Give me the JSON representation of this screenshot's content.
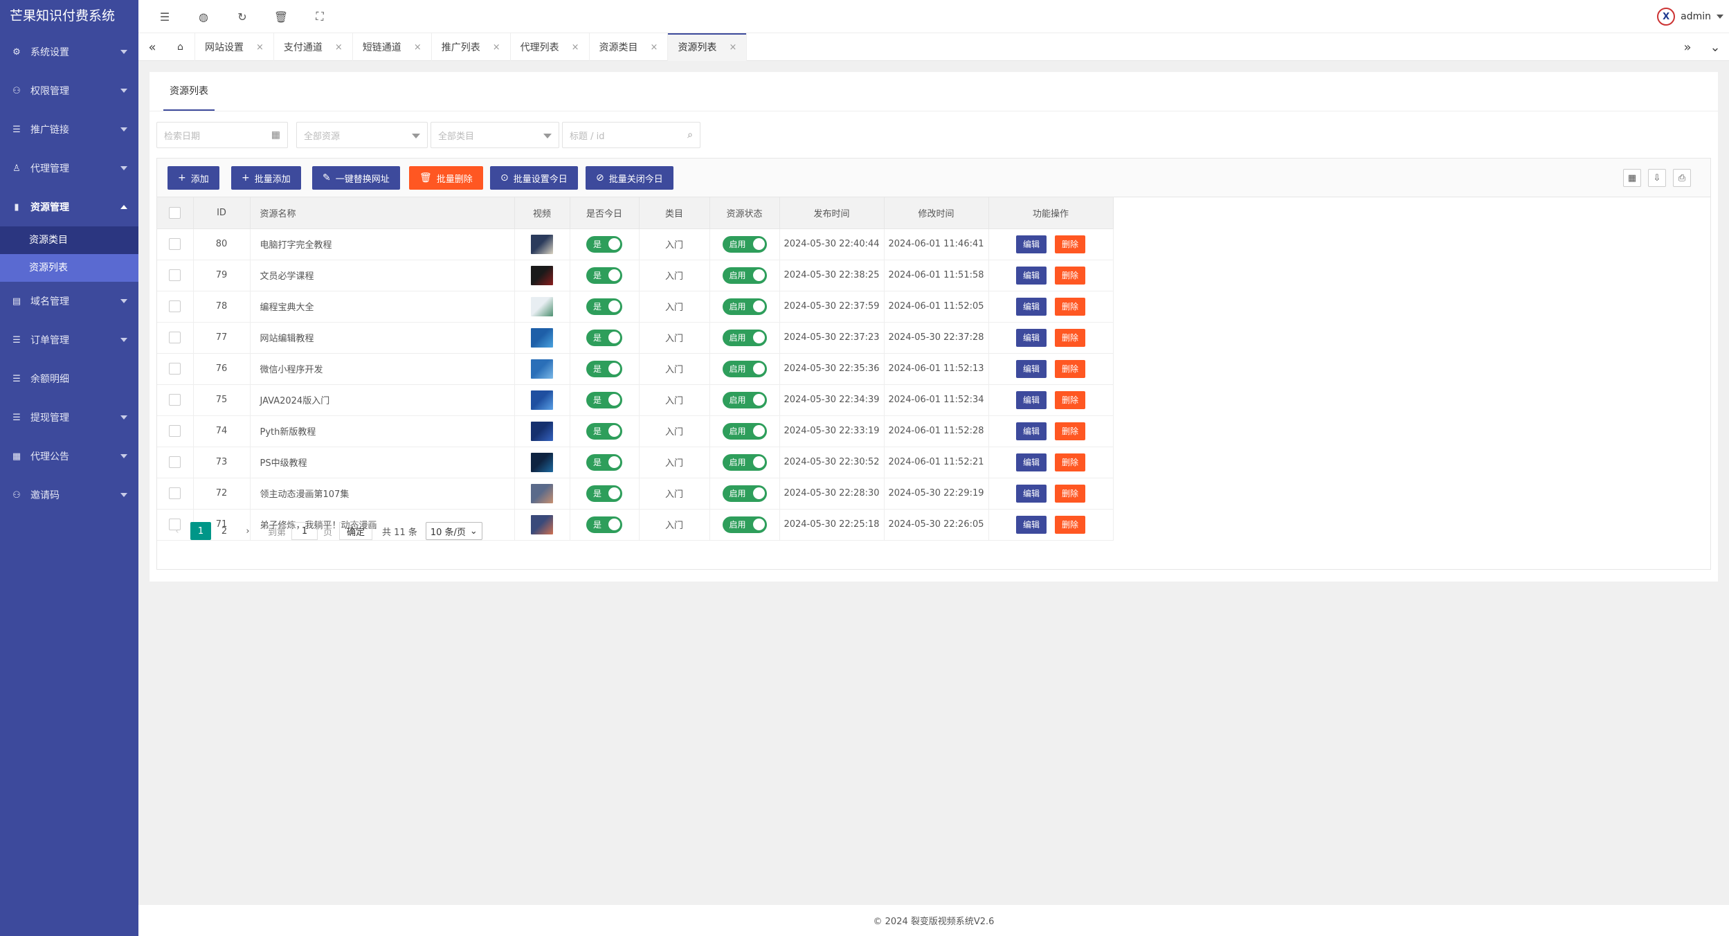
{
  "app": {
    "title": "芒果知识付费系统"
  },
  "colors": {
    "primary": "#3d4a9c",
    "danger": "#ff5722",
    "success": "#2e9e5b",
    "pager_active": "#009688"
  },
  "sidebar": {
    "items": [
      {
        "label": "系统设置",
        "icon": "gear-icon",
        "has_caret": true
      },
      {
        "label": "权限管理",
        "icon": "users-icon",
        "has_caret": true
      },
      {
        "label": "推广链接",
        "icon": "list-icon",
        "has_caret": true
      },
      {
        "label": "代理管理",
        "icon": "agent-icon",
        "has_caret": true
      },
      {
        "label": "资源管理",
        "icon": "book-icon",
        "has_caret": true,
        "open": true,
        "children": [
          {
            "label": "资源类目"
          },
          {
            "label": "资源列表",
            "active": true
          }
        ]
      },
      {
        "label": "域名管理",
        "icon": "domain-icon",
        "has_caret": true
      },
      {
        "label": "订单管理",
        "icon": "list-icon",
        "has_caret": true
      },
      {
        "label": "余额明细",
        "icon": "list-icon",
        "has_caret": false
      },
      {
        "label": "提现管理",
        "icon": "list-icon",
        "has_caret": true
      },
      {
        "label": "代理公告",
        "icon": "grid-icon",
        "has_caret": true
      },
      {
        "label": "邀请码",
        "icon": "users-icon",
        "has_caret": true
      }
    ]
  },
  "header": {
    "user": "admin"
  },
  "tabs": [
    {
      "label": "网站设置"
    },
    {
      "label": "支付通道"
    },
    {
      "label": "短链通道"
    },
    {
      "label": "推广列表"
    },
    {
      "label": "代理列表"
    },
    {
      "label": "资源类目"
    },
    {
      "label": "资源列表",
      "active": true
    }
  ],
  "card": {
    "tab_label": "资源列表"
  },
  "filters": {
    "date_placeholder": "检索日期",
    "resource_placeholder": "全部资源",
    "category_placeholder": "全部类目",
    "keyword_placeholder": "标题 / id"
  },
  "toolbar": {
    "add": "添加",
    "batch_add": "批量添加",
    "replace_url": "一键替换网址",
    "batch_delete": "批量删除",
    "batch_set_today": "批量设置今日",
    "batch_close_today": "批量关闭今日"
  },
  "table": {
    "columns": [
      "ID",
      "资源名称",
      "视频",
      "是否今日",
      "类目",
      "资源状态",
      "发布时间",
      "修改时间",
      "功能操作"
    ],
    "rows": [
      {
        "id": "80",
        "name": "电脑打字完全教程",
        "today": "是",
        "category": "入门",
        "status": "启用",
        "published": "2024-05-30 22:40:44",
        "modified": "2024-06-01 11:46:41",
        "thumb": [
          "#2b3b5c",
          "#d9d2c0"
        ]
      },
      {
        "id": "79",
        "name": "文员必学课程",
        "today": "是",
        "category": "入门",
        "status": "启用",
        "published": "2024-05-30 22:38:25",
        "modified": "2024-06-01 11:51:58",
        "thumb": [
          "#1a1a1a",
          "#8b1d1d"
        ]
      },
      {
        "id": "78",
        "name": "编程宝典大全",
        "today": "是",
        "category": "入门",
        "status": "启用",
        "published": "2024-05-30 22:37:59",
        "modified": "2024-06-01 11:52:05",
        "thumb": [
          "#e8eef2",
          "#4c8f6f"
        ]
      },
      {
        "id": "77",
        "name": "网站编辑教程",
        "today": "是",
        "category": "入门",
        "status": "启用",
        "published": "2024-05-30 22:37:23",
        "modified": "2024-05-30 22:37:28",
        "thumb": [
          "#1e5fa8",
          "#4aa3df"
        ]
      },
      {
        "id": "76",
        "name": "微信小程序开发",
        "today": "是",
        "category": "入门",
        "status": "启用",
        "published": "2024-05-30 22:35:36",
        "modified": "2024-06-01 11:52:13",
        "thumb": [
          "#2a6fb8",
          "#7ab8e8"
        ]
      },
      {
        "id": "75",
        "name": "JAVA2024版入门",
        "today": "是",
        "category": "入门",
        "status": "启用",
        "published": "2024-05-30 22:34:39",
        "modified": "2024-06-01 11:52:34",
        "thumb": [
          "#1f4fa0",
          "#5aa0e6"
        ]
      },
      {
        "id": "74",
        "name": "Pyth新版教程",
        "today": "是",
        "category": "入门",
        "status": "启用",
        "published": "2024-05-30 22:33:19",
        "modified": "2024-06-01 11:52:28",
        "thumb": [
          "#15306e",
          "#3563c0"
        ]
      },
      {
        "id": "73",
        "name": "PS中级教程",
        "today": "是",
        "category": "入门",
        "status": "启用",
        "published": "2024-05-30 22:30:52",
        "modified": "2024-06-01 11:52:21",
        "thumb": [
          "#0e2340",
          "#1e6aa0"
        ]
      },
      {
        "id": "72",
        "name": "领主动态漫画第107集",
        "today": "是",
        "category": "入门",
        "status": "启用",
        "published": "2024-05-30 22:28:30",
        "modified": "2024-05-30 22:29:19",
        "thumb": [
          "#5a6a8a",
          "#c89070"
        ]
      },
      {
        "id": "71",
        "name": "弟子修炼，我躺平！动态漫画",
        "today": "是",
        "category": "入门",
        "status": "启用",
        "published": "2024-05-30 22:25:18",
        "modified": "2024-05-30 22:26:05",
        "thumb": [
          "#3a4a7a",
          "#d07050"
        ]
      }
    ],
    "edit_label": "编辑",
    "delete_label": "删除"
  },
  "pagination": {
    "current": "1",
    "page2": "2",
    "goto_label": "到第",
    "goto_value": "1",
    "page_unit": "页",
    "confirm": "确定",
    "total": "共 11 条",
    "page_size": "10 条/页"
  },
  "footer": {
    "text": "© 2024 裂变版视频系统V2.6"
  }
}
